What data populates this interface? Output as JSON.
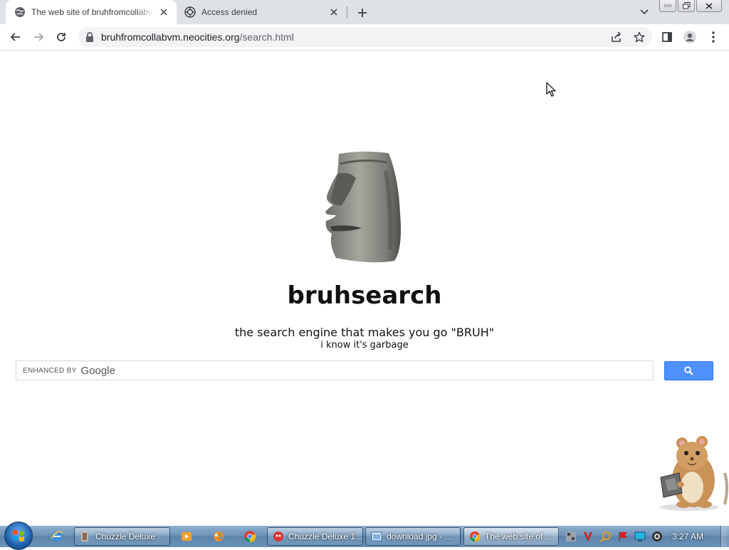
{
  "browser": {
    "tabs": [
      {
        "title": "The web site of bruhfromcollabvm",
        "favicon": "globe-icon",
        "active": true
      },
      {
        "title": "Access denied",
        "favicon": "shield-icon",
        "active": false
      }
    ],
    "url_host": "bruhfromcollabvm.neocities.org",
    "url_path": "/search.html"
  },
  "page": {
    "title": "bruhsearch",
    "tagline": "the search engine that makes you go \"BRUH\"",
    "subtitle": "i know it's garbage",
    "search": {
      "enhanced_label": "ENHANCED BY",
      "brand": "Google",
      "value": "",
      "button_icon": "search-icon"
    }
  },
  "taskbar": {
    "items": [
      {
        "label": "Chuzzle Deluxe",
        "icon": "chuzzle-icon",
        "active": false
      },
      {
        "label": "Chuzzle Deluxe 1...",
        "icon": "chuzzle-icon",
        "active": false
      },
      {
        "label": "download.jpg - ...",
        "icon": "paint-icon",
        "active": false
      },
      {
        "label": "The web site of ...",
        "icon": "chrome-icon",
        "active": true
      }
    ],
    "clock": "3:27 AM"
  },
  "colors": {
    "search_button": "#4d90fe",
    "tabstrip": "#dee1e6",
    "taskbar": "#6d93b8"
  }
}
